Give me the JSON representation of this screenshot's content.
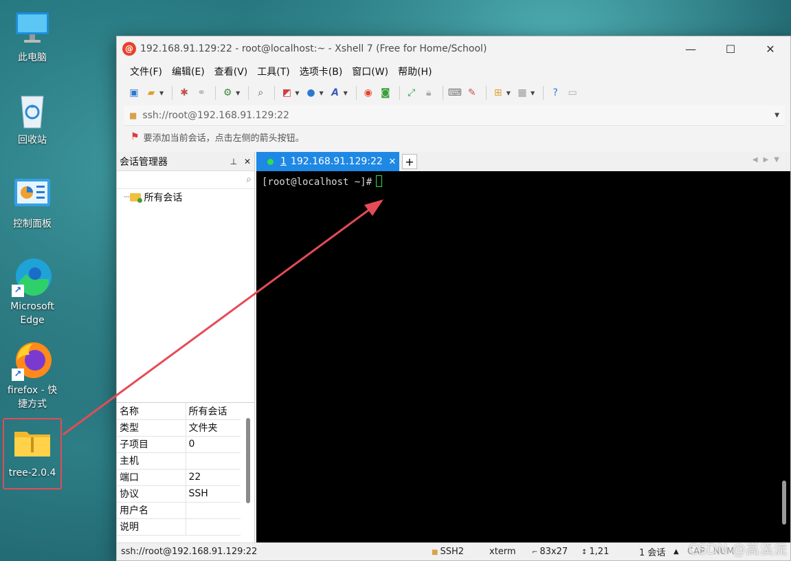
{
  "desktop": {
    "icons": [
      {
        "label": "此电脑"
      },
      {
        "label": "回收站"
      },
      {
        "label": "控制面板"
      },
      {
        "label": "Microsoft Edge"
      },
      {
        "label": "firefox - 快捷方式"
      },
      {
        "label": "tree-2.0.4"
      }
    ]
  },
  "window": {
    "title": "192.168.91.129:22 - root@localhost:~ - Xshell 7 (Free for Home/School)",
    "minimize": "—",
    "maximize": "☐",
    "close": "✕"
  },
  "menu": [
    "文件(F)",
    "编辑(E)",
    "查看(V)",
    "工具(T)",
    "选项卡(B)",
    "窗口(W)",
    "帮助(H)"
  ],
  "address": {
    "value": "ssh://root@192.168.91.129:22"
  },
  "hint": {
    "text": "要添加当前会话，点击左侧的箭头按钮。"
  },
  "session_manager": {
    "title": "会话管理器",
    "pin": "⊥",
    "close": "✕",
    "tree": [
      {
        "label": "所有会话"
      }
    ]
  },
  "properties": [
    {
      "key": "名称",
      "value": "所有会话"
    },
    {
      "key": "类型",
      "value": "文件夹"
    },
    {
      "key": "子项目",
      "value": "0"
    },
    {
      "key": "主机",
      "value": ""
    },
    {
      "key": "端口",
      "value": "22"
    },
    {
      "key": "协议",
      "value": "SSH"
    },
    {
      "key": "用户名",
      "value": ""
    },
    {
      "key": "说明",
      "value": ""
    }
  ],
  "tab": {
    "number": "1",
    "label": "192.168.91.129:22",
    "close": "✕",
    "add": "+"
  },
  "terminal": {
    "prompt": "[root@localhost ~]#"
  },
  "status": {
    "address": "ssh://root@192.168.91.129:22",
    "protocol": "SSH2",
    "term": "xterm",
    "size": "83x27",
    "position": "1,21",
    "sessions": "1 会话",
    "caps": "CAP",
    "num": "NUM"
  },
  "watermark": "CSDN @高溪流",
  "colors": {
    "accent": "#1e88e5",
    "arrow": "#e54b57",
    "cursor": "#2ee04b"
  }
}
